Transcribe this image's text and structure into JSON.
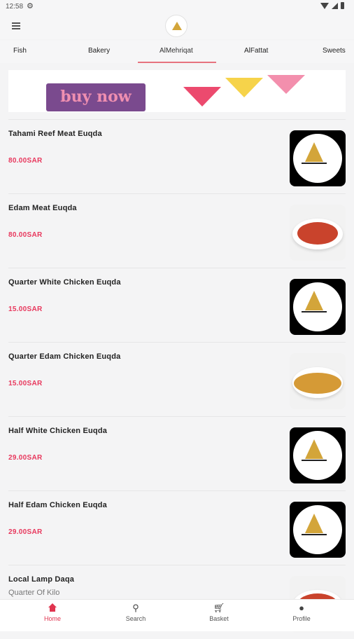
{
  "status": {
    "time": "12:58"
  },
  "tabs": [
    "Fish",
    "Bakery",
    "AlMehriqat",
    "AlFattat",
    "Sweets"
  ],
  "active_tab": "AlMehriqat",
  "banner": {
    "button_text": "buy now"
  },
  "items": [
    {
      "name": "Tahami Reef Meat Euqda",
      "price": "80.00SAR",
      "image": "logo"
    },
    {
      "name": "Edam Meat Euqda",
      "price": "80.00SAR",
      "image": "stew"
    },
    {
      "name": "Quarter White Chicken Euqda",
      "price": "15.00SAR",
      "image": "logo"
    },
    {
      "name": "Quarter Edam Chicken Euqda",
      "price": "15.00SAR",
      "image": "rice"
    },
    {
      "name": "Half White Chicken Euqda",
      "price": "29.00SAR",
      "image": "logo"
    },
    {
      "name": "Half Edam Chicken Euqda",
      "price": "29.00SAR",
      "image": "logo"
    },
    {
      "name": "Local Lamp Daqa",
      "subtitle": "Quarter Of Kilo",
      "image": "stew"
    }
  ],
  "nav": [
    {
      "label": "Home",
      "icon": "home-icon",
      "active": true
    },
    {
      "label": "Search",
      "icon": "search-icon",
      "active": false
    },
    {
      "label": "Basket",
      "icon": "basket-icon",
      "active": false
    },
    {
      "label": "Profile",
      "icon": "profile-icon",
      "active": false
    }
  ],
  "colors": {
    "accent": "#e0344f",
    "price": "#e8385d"
  }
}
